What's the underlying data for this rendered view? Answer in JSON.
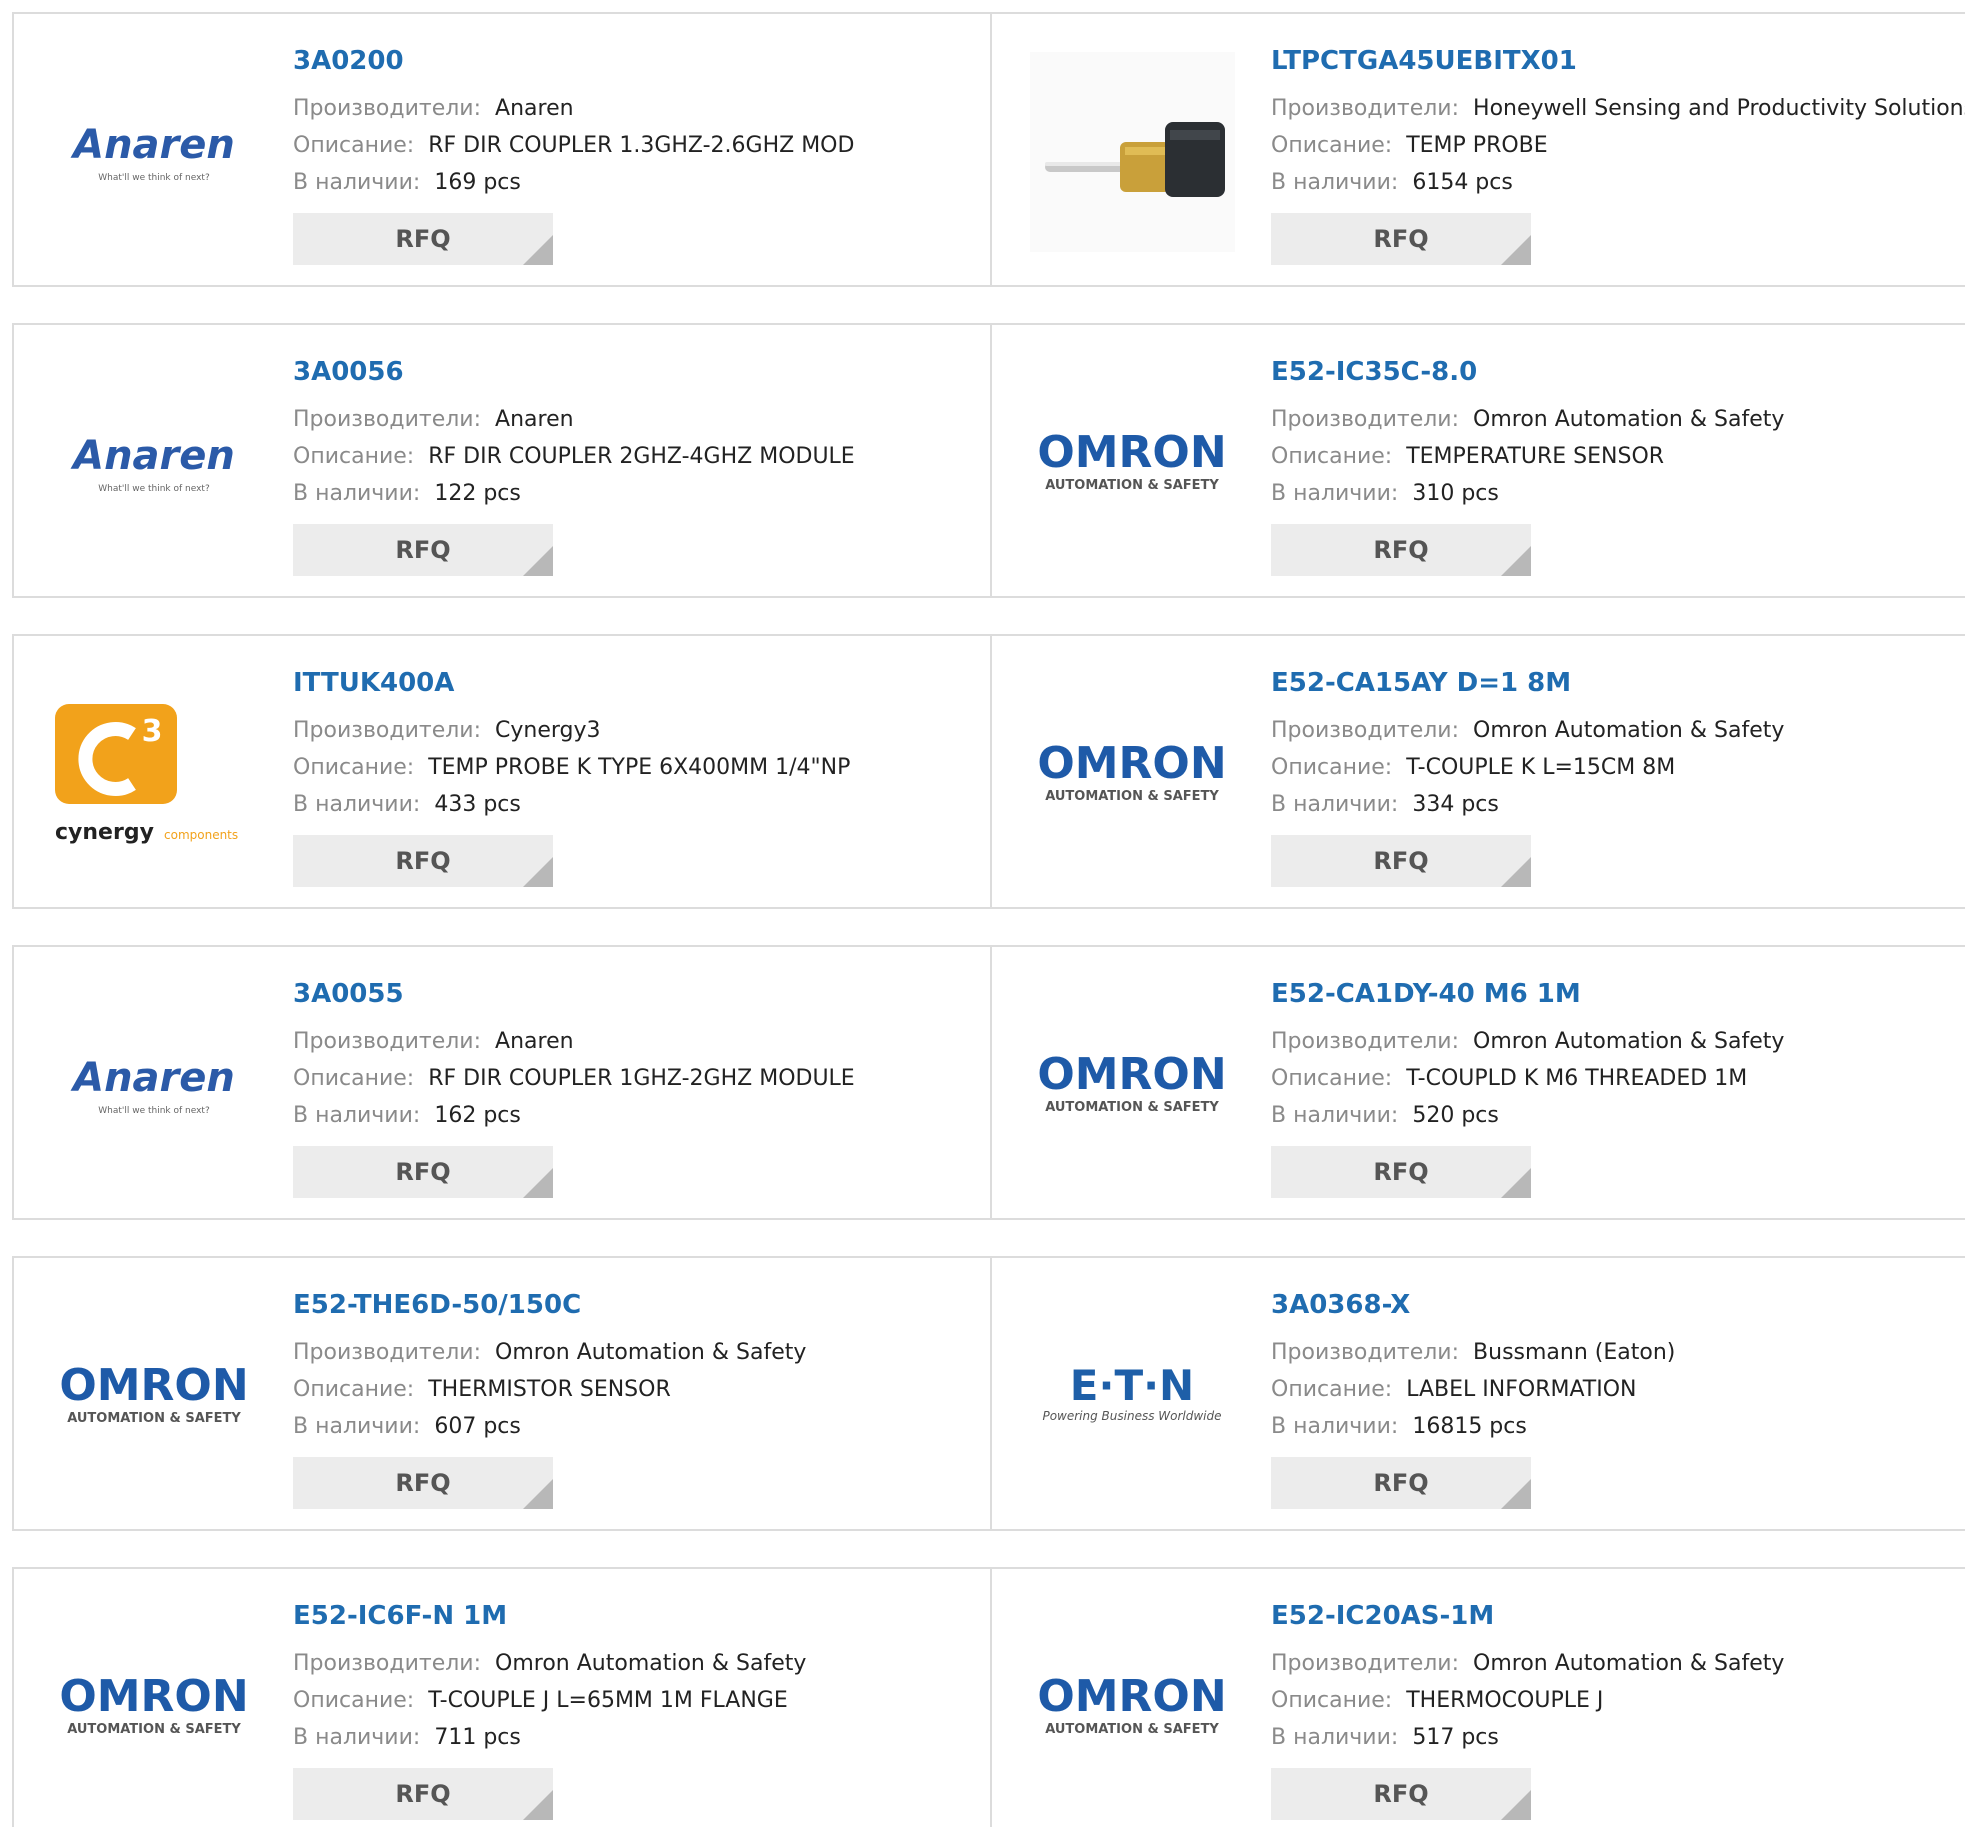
{
  "labels": {
    "manufacturer": "Производители:",
    "description": "Описание:",
    "stock": "В наличии:",
    "rfq": "RFQ"
  },
  "logo_text": {
    "anaren": "Anaren",
    "anaren_tagline": "What'll we think of next?",
    "omron": "OMRON",
    "omron_tagline": "AUTOMATION & SAFETY",
    "eaton": "E·T·N",
    "eaton_tagline": "Powering Business Worldwide",
    "cynergy": "cynergy",
    "cynergy_sub": "components",
    "cynergy_num": "3"
  },
  "colors": {
    "part_link": "#1f6cb0",
    "anaren_blue": "#2b5aa8",
    "omron_blue": "#1e5aa8",
    "eaton_blue": "#1e5fa8",
    "cynergy_orange": "#f2a21b"
  },
  "rows": [
    {
      "left": {
        "part": "3A0200",
        "manufacturer": "Anaren",
        "description": "RF DIR COUPLER 1.3GHZ-2.6GHZ MOD",
        "stock": "169 pcs",
        "logo": "anaren"
      },
      "right": {
        "part": "LTPCTGA45UEBITX01",
        "manufacturer": "Honeywell Sensing and Productivity Solutions",
        "description": "TEMP PROBE",
        "stock": "6154 pcs",
        "logo": "probe-photo"
      }
    },
    {
      "left": {
        "part": "3A0056",
        "manufacturer": "Anaren",
        "description": "RF DIR COUPLER 2GHZ-4GHZ MODULE",
        "stock": "122 pcs",
        "logo": "anaren"
      },
      "right": {
        "part": "E52-IC35C-8.0",
        "manufacturer": "Omron Automation & Safety",
        "description": "TEMPERATURE SENSOR",
        "stock": "310 pcs",
        "logo": "omron"
      }
    },
    {
      "left": {
        "part": "ITTUK400A",
        "manufacturer": "Cynergy3",
        "description": "TEMP PROBE K TYPE 6X400MM 1/4\"NP",
        "stock": "433 pcs",
        "logo": "cynergy3"
      },
      "right": {
        "part": "E52-CA15AY D=1 8M",
        "manufacturer": "Omron Automation & Safety",
        "description": "T-COUPLE K L=15CM 8M",
        "stock": "334 pcs",
        "logo": "omron"
      }
    },
    {
      "left": {
        "part": "3A0055",
        "manufacturer": "Anaren",
        "description": "RF DIR COUPLER 1GHZ-2GHZ MODULE",
        "stock": "162 pcs",
        "logo": "anaren"
      },
      "right": {
        "part": "E52-CA1DY-40 M6 1M",
        "manufacturer": "Omron Automation & Safety",
        "description": "T-COUPLD K M6 THREADED 1M",
        "stock": "520 pcs",
        "logo": "omron"
      }
    },
    {
      "left": {
        "part": "E52-THE6D-50/150C",
        "manufacturer": "Omron Automation & Safety",
        "description": "THERMISTOR SENSOR",
        "stock": "607 pcs",
        "logo": "omron"
      },
      "right": {
        "part": "3A0368-X",
        "manufacturer": "Bussmann (Eaton)",
        "description": "LABEL INFORMATION",
        "stock": "16815 pcs",
        "logo": "eaton"
      }
    },
    {
      "left": {
        "part": "E52-IC6F-N 1M",
        "manufacturer": "Omron Automation & Safety",
        "description": "T-COUPLE J L=65MM 1M FLANGE",
        "stock": "711 pcs",
        "logo": "omron"
      },
      "right": {
        "part": "E52-IC20AS-1M",
        "manufacturer": "Omron Automation & Safety",
        "description": "THERMOCOUPLE J",
        "stock": "517 pcs",
        "logo": "omron"
      }
    }
  ]
}
